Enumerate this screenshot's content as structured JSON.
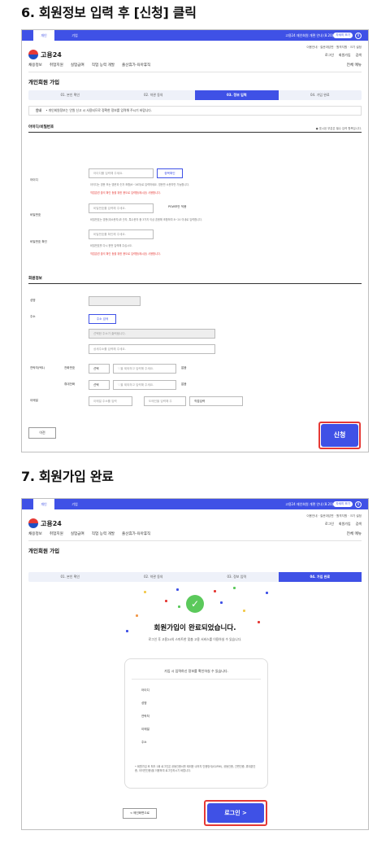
{
  "step6": {
    "heading": "6. 회원정보 입력 후 [신청] 클릭",
    "topbar": {
      "tab_personal": "개인",
      "tab_company": "기업",
      "notice": "고용24 재인회원 개편 안내 (8.20(수))",
      "detail_button": "자세히 보기",
      "pause": "II"
    },
    "util_links": "이용안내 · 질문과답변 · 원격지원 · 크기 설정",
    "logo": "고용24",
    "account": {
      "login": "로그인",
      "join": "회원가입",
      "search": "검색"
    },
    "gnb": [
      "채용정보",
      "취업지원",
      "실업급여",
      "직업 능력 개발",
      "출산휴가·육아휴직"
    ],
    "menu_all": "전체 메뉴",
    "page_title": "개인회원 가입",
    "progress": [
      "01. 본인 확인",
      "02. 약관 동의",
      "03. 정보 입력",
      "04. 가입 완료"
    ],
    "progress_current": 2,
    "notice_label": "안내",
    "notice_text": "• 개인회원정보는 안원 신고 시 사용되므로 정확한 정보를 입력해 주시기 바랍니다.",
    "section_account": "아이디/비밀번호",
    "required_note": "● 표시된 부분은 필수 입력 항목입니다.",
    "id_label": "아이디",
    "id_placeholder": "아이디를 입력해 주세요.",
    "dup_check": "중복확인",
    "id_help": "아이디는 영문 또는 영문과 숫자 조합(6~16자)로 입력하세요. 영문만 소문자만 가능합니다.",
    "id_warn": "직업훈련 출석 확인 등을 위한 용도로 입력합(제시된) 사용합니다.",
    "pw_label": "비밀번호",
    "pw_placeholder": "비밀번호를 입력해 주세요.",
    "pw_secure": "PSW보안 적용",
    "pw_help": "비밀번호는 영문(대소문자)과 숫자, 특수문자 중 3가지 이상 혼용해 조합하여 8~24 이내로 입력합니다.",
    "pw2_label": "비밀번호 확인",
    "pw2_placeholder": "비밀번호를 확인해 주세요.",
    "pw2_help": "비밀번호를 다시 한번 입력해 주십시오.",
    "pw2_warn": "직업훈련 출석 확인 등을 위한 용도로 입력합(제시된) 사용합니다.",
    "section_member": "회원정보",
    "name_label": "성명",
    "addr_label": "주소",
    "addr_search": "주소 검색",
    "addr_placeholder1": "선택한 주소가 출력됩니다.",
    "addr_placeholder2": "상세주소를 입력해 주세요.",
    "contact_label": "연락처(택1)",
    "phone_label": "전화번호",
    "mobile_label": "휴대전화",
    "select_label": "선택",
    "phone_placeholder": "'-'을 제외하고 입력해 주세요.",
    "none_label": "없음",
    "email_label": "이메일",
    "email_placeholder": "이메일 주소를 입력",
    "domain_placeholder": "도메인을 입력해 주",
    "direct_input": "직접입력",
    "prev_button": "이전",
    "submit_button": "신청"
  },
  "step7": {
    "heading": "7. 회원가입 완료",
    "page_title": "개인회원 가입",
    "progress": [
      "01. 본인 확인",
      "02. 약관 동의",
      "03. 정보 입력",
      "04. 가입 완료"
    ],
    "progress_current": 3,
    "done_title": "회원가입이 완료되었습니다.",
    "done_sub": "로그인 후 고용24의 스마트한 맞춤 고용 서비스를 이용하실 수 있습니다.",
    "card_header": "가입 시 입력하신 정보를 확인하실 수 있습니다.",
    "rows": [
      "아이디",
      "성명",
      "연락처",
      "이메일",
      "주소"
    ],
    "card_note": "• 회원가입 후 최초 1회 로그인은 공동인증서를 제외한 나머지 인증방식(ID/PW), 공동인증, 간편인증, 휴대폰인증, 아이핀인증)을 이용하여 로그인하시기 바랍니다.",
    "main_button": "< 메인화면으로",
    "login_button": "로그인 >"
  },
  "colors": {
    "brand": "#3f51e6",
    "highlight": "#e53935",
    "success": "#5bc95b"
  }
}
